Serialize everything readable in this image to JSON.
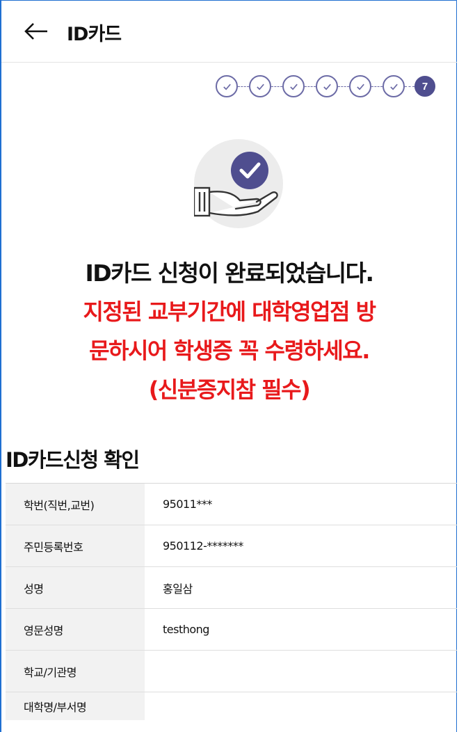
{
  "header": {
    "title": "ID카드"
  },
  "stepper": {
    "completed_count": 6,
    "current_step": "7",
    "total_steps": 7
  },
  "message": {
    "headline": "ID카드 신청이 완료되었습니다.",
    "notice_line1": "지정된 교부기간에 대학영업점 방",
    "notice_line2": "문하시어 학생증 꼭 수령하세요.",
    "notice_line3": "(신분증지참 필수)",
    "notice_color": "#e8191b"
  },
  "confirm": {
    "title": "ID카드신청 확인",
    "rows": [
      {
        "label": "학번(직번,교번)",
        "value": "95011***"
      },
      {
        "label": "주민등록번호",
        "value": "950112-*******"
      },
      {
        "label": "성명",
        "value": "홍일삼"
      },
      {
        "label": "영문성명",
        "value": "testhong"
      },
      {
        "label": "학교/기관명",
        "value": ""
      },
      {
        "label": "대학명/부서명",
        "value": ""
      }
    ]
  },
  "colors": {
    "accent": "#4f4e8f",
    "frame": "#1f6fd1"
  }
}
